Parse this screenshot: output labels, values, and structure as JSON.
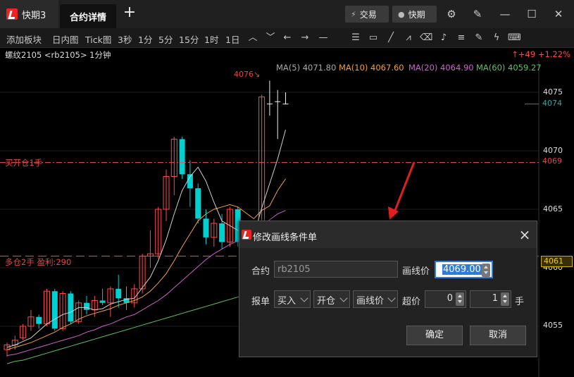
{
  "titlebar": {
    "app_name": "快期3",
    "active_tab": "合约详情",
    "plus": "+",
    "trade_label": "交易",
    "quick_label": "快期"
  },
  "toolbar": {
    "items": [
      "添加板块",
      "日内图",
      "Tick图",
      "3秒",
      "1分",
      "5分",
      "15分",
      "1时",
      "1日"
    ]
  },
  "info": {
    "contract": "螺纹2105 <rb2105> 1分钟",
    "change": "↑+49 +1.22%"
  },
  "ma": {
    "ma5": "MA(5) 4071.80",
    "ma10": "MA(10) 4067.60",
    "ma20": "MA(20) 4064.90",
    "ma60": "MA(60) 4059.27"
  },
  "colors": {
    "ma5": "#d0d0d0",
    "ma10": "#f0a040",
    "ma20": "#d060d0",
    "ma60": "#60c060",
    "up": "#ff4a4a",
    "down": "#00d0d0"
  },
  "chart": {
    "peak_label": "4076↘",
    "axis_prices": [
      "4075",
      "4070",
      "4065",
      "4060",
      "4055"
    ],
    "tag_last": "4074",
    "tag_buy": "4069",
    "tag_hold": "4061",
    "buy_line_label": "买开仓1手",
    "hold_line_label": "多仓2手 盈利:290"
  },
  "dialog": {
    "title": "修改画线条件单",
    "contract_label": "合约",
    "contract_value": "rb2105",
    "line_price_label": "画线价",
    "line_price_value": "4069.00",
    "order_label": "报单",
    "direction": "买入",
    "offset": "开仓",
    "price_type": "画线价",
    "overprice_label": "超价",
    "overprice_value": "0",
    "qty_value": "1",
    "qty_unit": "手",
    "ok_label": "确定",
    "cancel_label": "取消"
  },
  "chart_data": {
    "type": "candlestick",
    "y_range": [
      4053,
      4078
    ],
    "y_ticks": [
      4055,
      4060,
      4065,
      4070,
      4075
    ],
    "candles": [
      {
        "o": 4053.0,
        "h": 4053.6,
        "l": 4052.4,
        "c": 4053.4
      },
      {
        "o": 4053.4,
        "h": 4054.2,
        "l": 4053.0,
        "c": 4053.8
      },
      {
        "o": 4054.0,
        "h": 4055.2,
        "l": 4053.8,
        "c": 4055.0
      },
      {
        "o": 4055.0,
        "h": 4056.4,
        "l": 4054.6,
        "c": 4055.8
      },
      {
        "o": 4055.8,
        "h": 4056.0,
        "l": 4054.8,
        "c": 4055.2
      },
      {
        "o": 4055.2,
        "h": 4058.2,
        "l": 4055.0,
        "c": 4058.0
      },
      {
        "o": 4058.0,
        "h": 4058.2,
        "l": 4054.6,
        "c": 4054.8
      },
      {
        "o": 4054.8,
        "h": 4058.0,
        "l": 4054.6,
        "c": 4057.8
      },
      {
        "o": 4057.8,
        "h": 4058.0,
        "l": 4055.2,
        "c": 4055.4
      },
      {
        "o": 4055.4,
        "h": 4057.2,
        "l": 4055.2,
        "c": 4057.0
      },
      {
        "o": 4057.0,
        "h": 4057.6,
        "l": 4056.0,
        "c": 4056.4
      },
      {
        "o": 4056.4,
        "h": 4057.6,
        "l": 4055.8,
        "c": 4057.2
      },
      {
        "o": 4057.2,
        "h": 4058.2,
        "l": 4056.8,
        "c": 4057.0
      },
      {
        "o": 4057.0,
        "h": 4058.4,
        "l": 4055.8,
        "c": 4058.2
      },
      {
        "o": 4058.2,
        "h": 4059.4,
        "l": 4056.6,
        "c": 4057.4
      },
      {
        "o": 4057.4,
        "h": 4058.4,
        "l": 4056.4,
        "c": 4057.0
      },
      {
        "o": 4057.0,
        "h": 4058.6,
        "l": 4056.6,
        "c": 4058.2
      },
      {
        "o": 4058.2,
        "h": 4061.2,
        "l": 4057.8,
        "c": 4061.0
      },
      {
        "o": 4061.0,
        "h": 4063.2,
        "l": 4060.0,
        "c": 4061.2
      },
      {
        "o": 4061.2,
        "h": 4065.2,
        "l": 4060.8,
        "c": 4065.0
      },
      {
        "o": 4065.0,
        "h": 4068.4,
        "l": 4064.0,
        "c": 4067.8
      },
      {
        "o": 4067.8,
        "h": 4071.2,
        "l": 4066.2,
        "c": 4071.0
      },
      {
        "o": 4071.0,
        "h": 4071.2,
        "l": 4067.6,
        "c": 4068.0
      },
      {
        "o": 4068.0,
        "h": 4069.2,
        "l": 4065.2,
        "c": 4066.8
      },
      {
        "o": 4066.8,
        "h": 4067.2,
        "l": 4063.8,
        "c": 4064.2
      },
      {
        "o": 4064.2,
        "h": 4065.0,
        "l": 4062.0,
        "c": 4062.6
      },
      {
        "o": 4062.6,
        "h": 4064.2,
        "l": 4061.8,
        "c": 4063.8
      },
      {
        "o": 4063.8,
        "h": 4064.6,
        "l": 4061.6,
        "c": 4062.2
      },
      {
        "o": 4062.2,
        "h": 4065.2,
        "l": 4061.8,
        "c": 4065.0
      },
      {
        "o": 4065.0,
        "h": 4065.2,
        "l": 4061.8,
        "c": 4062.2
      },
      {
        "o": 4062.2,
        "h": 4063.6,
        "l": 4061.6,
        "c": 4063.4
      },
      {
        "o": 4063.4,
        "h": 4064.0,
        "l": 4061.2,
        "c": 4061.8
      },
      {
        "o": 4061.8,
        "h": 4074.8,
        "l": 4061.2,
        "c": 4074.6
      },
      {
        "o": 4074.0,
        "h": 4076.0,
        "l": 4073.0,
        "c": 4074.0
      },
      {
        "o": 4074.2,
        "h": 4075.2,
        "l": 4071.0,
        "c": 4074.2
      },
      {
        "o": 4074.0,
        "h": 4075.0,
        "l": 4074.0,
        "c": 4074.0
      }
    ],
    "ma5": [
      4053.2,
      4053.4,
      4053.7,
      4054.0,
      4054.6,
      4055.2,
      4055.6,
      4056.0,
      4056.2,
      4056.6,
      4056.6,
      4056.4,
      4056.5,
      4056.9,
      4057.1,
      4057.3,
      4057.4,
      4058.3,
      4059.2,
      4060.6,
      4062.4,
      4064.6,
      4066.6,
      4067.8,
      4068.6,
      4067.4,
      4065.6,
      4064.0,
      4063.6,
      4063.2,
      4062.9,
      4062.8,
      4065.1,
      4067.2,
      4069.3,
      4071.8
    ],
    "ma10": [
      4053.0,
      4053.2,
      4053.4,
      4053.6,
      4053.9,
      4054.2,
      4054.5,
      4054.9,
      4055.2,
      4055.6,
      4055.9,
      4056.1,
      4056.3,
      4056.5,
      4056.8,
      4057.0,
      4057.2,
      4057.5,
      4058.0,
      4058.7,
      4059.5,
      4060.6,
      4061.8,
      4062.9,
      4064.0,
      4064.6,
      4065.0,
      4065.2,
      4065.4,
      4065.2,
      4064.7,
      4064.2,
      4064.9,
      4065.3,
      4066.6,
      4067.6
    ],
    "ma20": [
      4052.5,
      4052.6,
      4052.8,
      4053.0,
      4053.2,
      4053.4,
      4053.6,
      4053.8,
      4054.0,
      4054.2,
      4054.5,
      4054.7,
      4055.0,
      4055.2,
      4055.5,
      4055.8,
      4056.0,
      4056.4,
      4056.8,
      4057.2,
      4057.7,
      4058.3,
      4058.9,
      4059.5,
      4060.1,
      4060.7,
      4061.2,
      4061.6,
      4062.0,
      4062.3,
      4062.6,
      4062.9,
      4063.6,
      4064.1,
      4064.6,
      4064.9
    ],
    "ma60": [
      4051.8,
      4052.0,
      4052.1,
      4052.3,
      4052.5,
      4052.7,
      4052.9,
      4053.1,
      4053.3,
      4053.5,
      4053.7,
      4053.9,
      4054.1,
      4054.3,
      4054.5,
      4054.7,
      4054.9,
      4055.1,
      4055.3,
      4055.5,
      4055.7,
      4055.9,
      4056.1,
      4056.3,
      4056.5,
      4056.7,
      4056.9,
      4057.1,
      4057.3,
      4057.5,
      4057.7,
      4057.9,
      4058.2,
      4058.5,
      4058.9,
      4059.27
    ]
  }
}
